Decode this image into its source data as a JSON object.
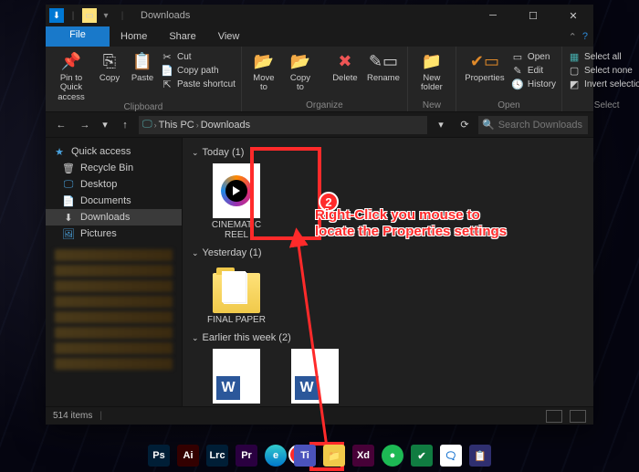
{
  "window": {
    "title": "Downloads",
    "tabs": {
      "file": "File",
      "home": "Home",
      "share": "Share",
      "view": "View"
    }
  },
  "ribbon": {
    "clipboard": {
      "label": "Clipboard",
      "pin": "Pin to Quick\naccess",
      "copy": "Copy",
      "paste": "Paste",
      "cut": "Cut",
      "copy_path": "Copy path",
      "paste_shortcut": "Paste shortcut"
    },
    "organize": {
      "label": "Organize",
      "move_to": "Move\nto",
      "copy_to": "Copy\nto",
      "delete": "Delete",
      "rename": "Rename"
    },
    "new": {
      "label": "New",
      "new_folder": "New\nfolder"
    },
    "open": {
      "label": "Open",
      "properties": "Properties",
      "open": "Open",
      "edit": "Edit",
      "history": "History"
    },
    "select": {
      "label": "Select",
      "select_all": "Select all",
      "select_none": "Select none",
      "invert": "Invert selection"
    }
  },
  "address": {
    "this_pc": "This PC",
    "downloads": "Downloads",
    "search_placeholder": "Search Downloads"
  },
  "nav": {
    "quick_access": "Quick access",
    "recycle_bin": "Recycle Bin",
    "desktop": "Desktop",
    "documents": "Documents",
    "downloads": "Downloads",
    "pictures": "Pictures"
  },
  "groups": {
    "today": "Today (1)",
    "yesterday": "Yesterday (1)",
    "earlier": "Earlier this week (2)"
  },
  "files": {
    "cinematic": "CINEMATIC REEL",
    "final_paper": "FINAL PAPER",
    "doc_w": "W"
  },
  "status": {
    "items": "514 items"
  },
  "annotation": {
    "step1": "1",
    "step2": "2",
    "text": "Right-Click you mouse to\nlocate the Properties settings"
  },
  "taskbar_apps": [
    "Ps",
    "Ai",
    "Lrc",
    "Pr",
    "e",
    "Ti",
    "📁",
    "Xd",
    "●",
    "✔",
    "🗨",
    "📋"
  ]
}
